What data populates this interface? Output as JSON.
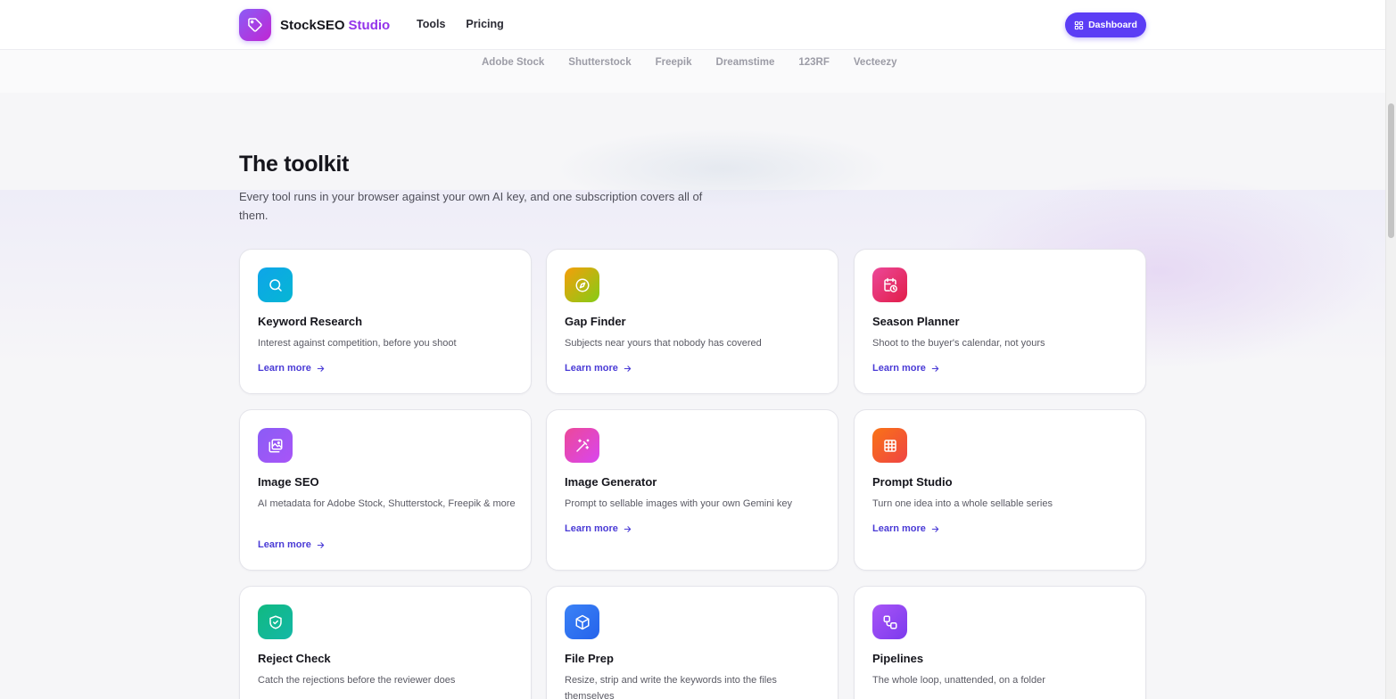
{
  "header": {
    "brand_name": "StockSEO",
    "brand_accent": "Studio",
    "nav": [
      "Tools",
      "Pricing"
    ],
    "dashboard_label": "Dashboard",
    "brand_color": "#9333ea",
    "button_color": "#5b3df5"
  },
  "marketplaces": [
    "Adobe Stock",
    "Shutterstock",
    "Freepik",
    "Dreamstime",
    "123RF",
    "Vecteezy"
  ],
  "toolkit": {
    "title": "The toolkit",
    "subtitle": "Every tool runs in your browser against your own AI key, and one subscription covers all of them.",
    "link_label": "Learn more",
    "tools": [
      {
        "title": "Keyword Research",
        "desc": "Interest against competition, before you shoot",
        "icon": "search-icon",
        "gradient": [
          "#0ea5e9",
          "#06b6d4"
        ]
      },
      {
        "title": "Gap Finder",
        "desc": "Subjects near yours that nobody has covered",
        "icon": "compass-icon",
        "gradient": [
          "#f59e0b",
          "#84cc16"
        ]
      },
      {
        "title": "Season Planner",
        "desc": "Shoot to the buyer's calendar, not yours",
        "icon": "calendar-clock-icon",
        "gradient": [
          "#ec4899",
          "#e11d48"
        ]
      },
      {
        "title": "Image SEO",
        "desc": "AI metadata for Adobe Stock, Shutterstock, Freepik & more",
        "icon": "image-icon",
        "gradient": [
          "#8b5cf6",
          "#a855f7"
        ]
      },
      {
        "title": "Image Generator",
        "desc": "Prompt to sellable images with your own Gemini key",
        "icon": "magic-wand-icon",
        "gradient": [
          "#ec4899",
          "#d946ef"
        ]
      },
      {
        "title": "Prompt Studio",
        "desc": "Turn one idea into a whole sellable series",
        "icon": "grid-icon",
        "gradient": [
          "#f97316",
          "#ef4444"
        ]
      },
      {
        "title": "Reject Check",
        "desc": "Catch the rejections before the reviewer does",
        "icon": "shield-check-icon",
        "gradient": [
          "#10b981",
          "#14b8a6"
        ]
      },
      {
        "title": "File Prep",
        "desc": "Resize, strip and write the keywords into the files themselves",
        "icon": "box-icon",
        "gradient": [
          "#3b82f6",
          "#2563eb"
        ]
      },
      {
        "title": "Pipelines",
        "desc": "The whole loop, unattended, on a folder",
        "icon": "workflow-icon",
        "gradient": [
          "#a855f7",
          "#7c3aed"
        ]
      }
    ]
  }
}
